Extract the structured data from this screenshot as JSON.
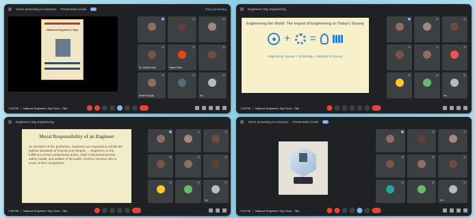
{
  "colors": {
    "accent": "#8ab4f8",
    "end_call": "#ea4335",
    "tile": "#3c4043"
  },
  "panel1": {
    "topbar": {
      "presenting": "You're presenting to everyone",
      "mode": "Presentation mode",
      "action": "Stop presenting"
    },
    "poster": {
      "title": "National Engineers' Day"
    },
    "participants": [
      {
        "name": "",
        "color": "#8d6e63"
      },
      {
        "name": "",
        "color": "#5d4037"
      },
      {
        "name": "",
        "color": "#a1887f"
      },
      {
        "name": "Sk. Abhijit Kumar",
        "color": "#795548"
      },
      {
        "name": "Nigam Sinha",
        "color": "#e64a19"
      },
      {
        "name": "",
        "color": "#6d4c41"
      },
      {
        "name": "Arnab Ganguly",
        "color": "#8d6e63"
      },
      {
        "name": "",
        "color": "#546e7a"
      },
      {
        "name": "You",
        "color": "#b0bec5"
      }
    ],
    "bottom": {
      "time": "7:16 PM",
      "meeting": "National Engineers' Day Torch - Talk"
    }
  },
  "panel2": {
    "topbar": {
      "presenting": "Engineers' Day Engineering"
    },
    "slide": {
      "title": "Engineering the World: The Impact of Engineering on Today's Society",
      "subtitle": "",
      "formula": "Engineering: Science + Technology = Solutions for Society"
    },
    "participants": [
      {
        "name": "",
        "color": "#8d6e63"
      },
      {
        "name": "",
        "color": "#a1887f"
      },
      {
        "name": "",
        "color": "#6d4c41"
      },
      {
        "name": "",
        "color": "#795548"
      },
      {
        "name": "",
        "color": "#8d6e63"
      },
      {
        "name": "",
        "color": "#ef5350"
      },
      {
        "name": "",
        "color": "#ffca28"
      },
      {
        "name": "",
        "color": "#66bb6a"
      },
      {
        "name": "You",
        "color": "#b0bec5"
      }
    ],
    "bottom": {
      "time": "7:26 PM",
      "meeting": "National Engineers' Day Torch - Talk"
    }
  },
  "panel3": {
    "topbar": {
      "presenting": "Engineers' Day Engineering"
    },
    "slide": {
      "title": "Moral Responsibility of an Engineer",
      "body": "As members of this profession, engineers are expected to exhibit the highest standards of honesty and integrity. ... Engineers, in the fulfillment of their professional duties, shall: Hold paramount the safety, health, and welfare of the public. Perform services only in areas of their competence."
    },
    "participants": [
      {
        "name": "",
        "color": "#8d6e63"
      },
      {
        "name": "",
        "color": "#a1887f"
      },
      {
        "name": "",
        "color": "#6d4c41"
      },
      {
        "name": "",
        "color": "#795548"
      },
      {
        "name": "",
        "color": "#8d6e63"
      },
      {
        "name": "",
        "color": "#5d4037"
      },
      {
        "name": "",
        "color": "#ffca28"
      },
      {
        "name": "",
        "color": "#66bb6a"
      },
      {
        "name": "You",
        "color": "#b0bec5"
      }
    ],
    "bottom": {
      "time": "7:38 PM",
      "meeting": "National Engineers' Day Torch - Talk"
    }
  },
  "panel4": {
    "topbar": {
      "presenting": "You're presenting to everyone",
      "mode": "Presentation mode"
    },
    "participants": [
      {
        "name": "",
        "color": "#8d6e63"
      },
      {
        "name": "",
        "color": "#5d4037"
      },
      {
        "name": "",
        "color": "#a1887f"
      },
      {
        "name": "",
        "color": "#795548"
      },
      {
        "name": "",
        "color": "#8d6e63"
      },
      {
        "name": "",
        "color": "#6d4c41"
      },
      {
        "name": "",
        "color": "#26a69a"
      },
      {
        "name": "",
        "color": "#66bb6a"
      },
      {
        "name": "You",
        "color": "#b0bec5"
      }
    ],
    "bottom": {
      "time": "7:52 PM",
      "meeting": "National Engineers' Day Torch - Talk"
    }
  }
}
